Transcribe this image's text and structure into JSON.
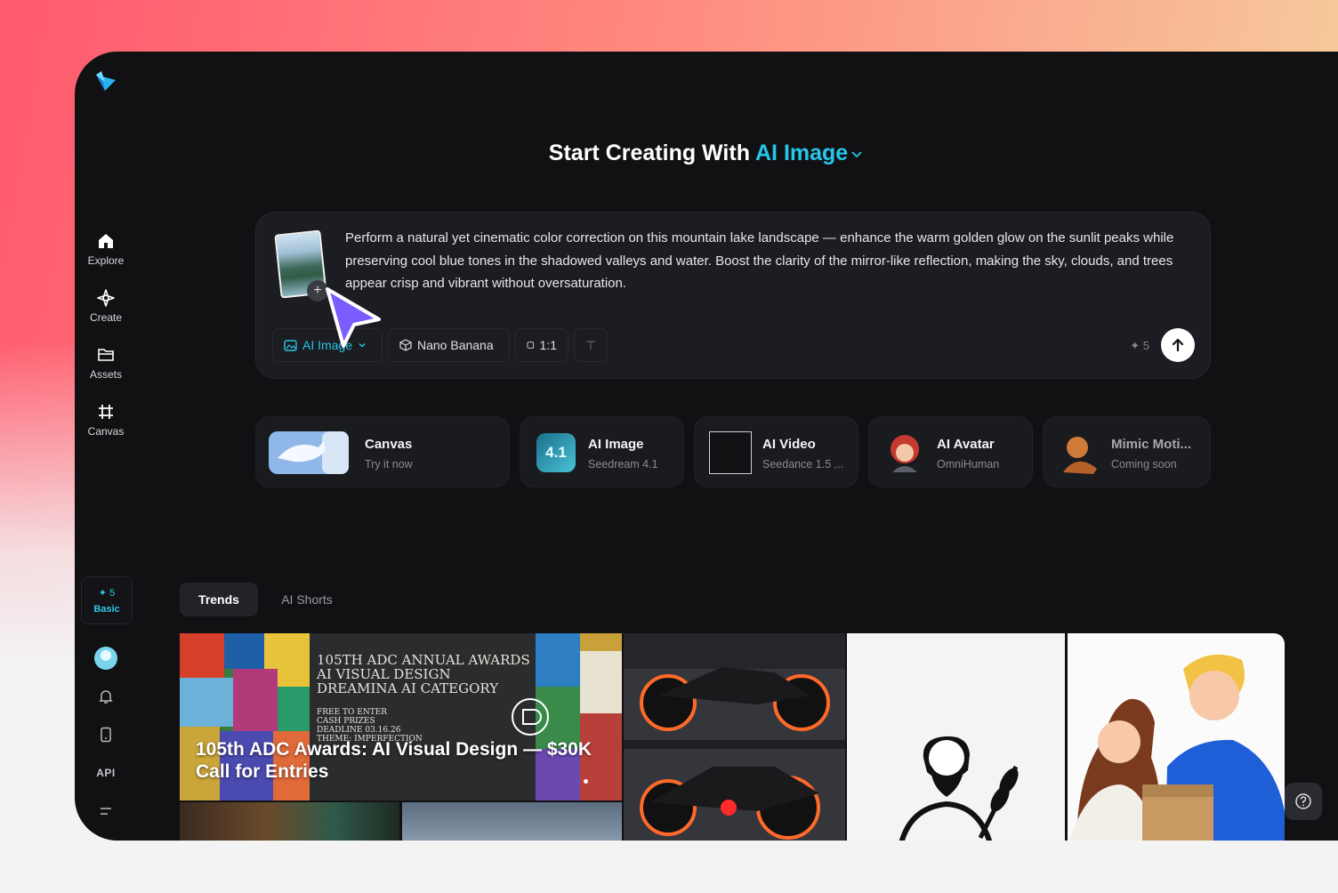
{
  "sidebar": {
    "items": [
      {
        "label": "Explore",
        "icon": "home-icon"
      },
      {
        "label": "Create",
        "icon": "sparkle-icon"
      },
      {
        "label": "Assets",
        "icon": "folder-icon"
      },
      {
        "label": "Canvas",
        "icon": "canvas-icon"
      }
    ],
    "credits": {
      "count": "5",
      "plan": "Basic"
    },
    "api_label": "API"
  },
  "hero": {
    "prefix": "Start Creating With",
    "accent": "AI Image"
  },
  "prompt": {
    "text": "Perform a natural yet cinematic color correction on this mountain lake landscape — enhance the warm golden glow on the sunlit peaks while preserving cool blue tones in the shadowed valleys and water. Boost the clarity of the mirror-like reflection, making the sky, clouds, and trees appear crisp and vibrant without oversaturation.",
    "tool_mode": "AI Image",
    "tool_model": "Nano Banana",
    "tool_ratio": "1:1",
    "cost": "5"
  },
  "cards": [
    {
      "title": "Canvas",
      "subtitle": "Try it now"
    },
    {
      "title": "AI Image",
      "subtitle": "Seedream 4.1",
      "badge": "4.1"
    },
    {
      "title": "AI Video",
      "subtitle": "Seedance 1.5 ..."
    },
    {
      "title": "AI Avatar",
      "subtitle": "OmniHuman"
    },
    {
      "title": "Mimic Moti...",
      "subtitle": "Coming soon"
    }
  ],
  "tabs": {
    "active": "Trends",
    "other": "AI Shorts"
  },
  "gallery": {
    "banner_line1": "105th ADC Awards: AI Visual Design — $30K",
    "banner_line2": "Call for Entries",
    "poster_title": "105TH ADC ANNUAL AWARDS",
    "poster_sub1": "AI VISUAL DESIGN",
    "poster_sub2": "DREAMINA AI CATEGORY",
    "poster_small1": "FREE TO ENTER",
    "poster_small2": "CASH PRIZES",
    "poster_small3": "DEADLINE 03.16.26",
    "poster_small4": "THEME: IMPERFECTION"
  },
  "colors": {
    "accent": "#26c6e8",
    "panel": "#111114",
    "card": "#1a1b1f"
  }
}
